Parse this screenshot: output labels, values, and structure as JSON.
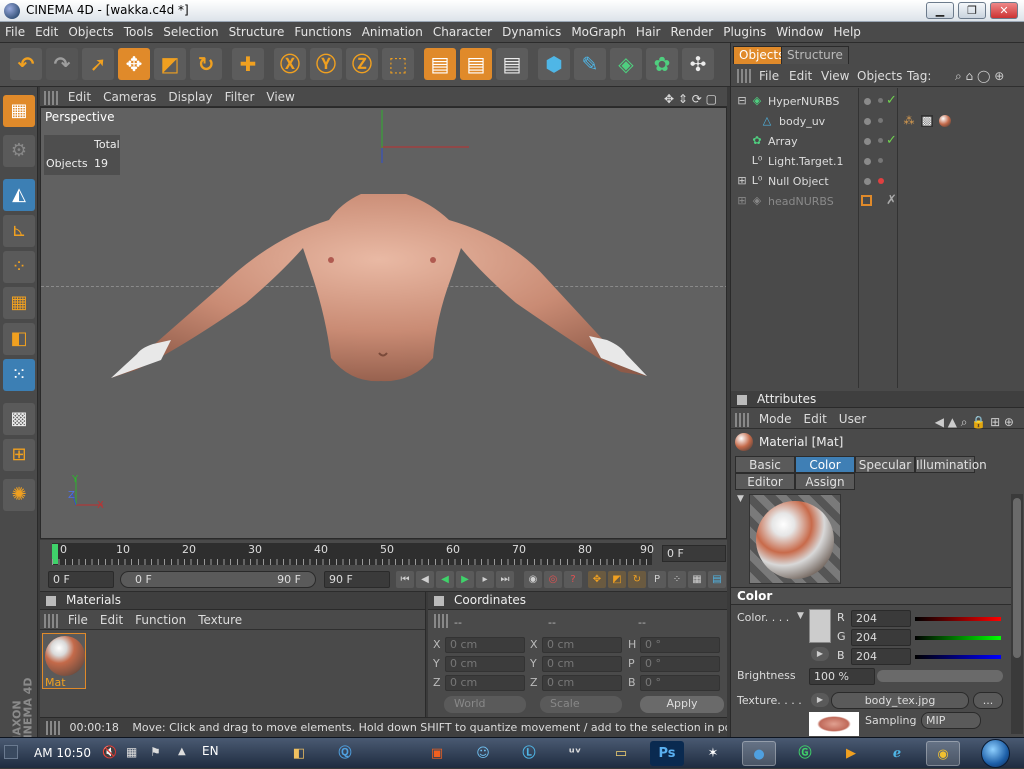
{
  "window": {
    "title": "CINEMA 4D - [wakka.c4d *]",
    "min": "▁",
    "max": "❐",
    "close": "✕"
  },
  "menubar": [
    "File",
    "Edit",
    "Objects",
    "Tools",
    "Selection",
    "Structure",
    "Functions",
    "Animation",
    "Character",
    "Dynamics",
    "MoGraph",
    "Hair",
    "Render",
    "Plugins",
    "Window",
    "Help"
  ],
  "viewport": {
    "menu": [
      "Edit",
      "Cameras",
      "Display",
      "Filter",
      "View"
    ],
    "label": "Perspective",
    "hud": {
      "header": "Total",
      "row_label": "Objects",
      "row_value": "19"
    },
    "axes": {
      "x": "X",
      "y": "Y",
      "z": "Z"
    }
  },
  "timeline": {
    "ticks": [
      "0",
      "10",
      "20",
      "30",
      "40",
      "50",
      "60",
      "70",
      "80",
      "90"
    ],
    "current_frame": "0 F",
    "start_field": "0 F",
    "range_start": "0 F",
    "range_end": "90 F",
    "end_field": "90 F"
  },
  "materials": {
    "title": "Materials",
    "menu": [
      "File",
      "Edit",
      "Function",
      "Texture"
    ],
    "items": [
      {
        "label": "Mat"
      }
    ]
  },
  "coordinates": {
    "title": "Coordinates",
    "col_headers": [
      "--",
      "--",
      "--"
    ],
    "rows": [
      {
        "a_label": "X",
        "a_value": "0 cm",
        "b_label": "X",
        "b_value": "0 cm",
        "c_label": "H",
        "c_value": "0 °"
      },
      {
        "a_label": "Y",
        "a_value": "0 cm",
        "b_label": "Y",
        "b_value": "0 cm",
        "c_label": "P",
        "c_value": "0 °"
      },
      {
        "a_label": "Z",
        "a_value": "0 cm",
        "b_label": "Z",
        "b_value": "0 cm",
        "c_label": "B",
        "c_value": "0 °"
      }
    ],
    "mode_select": "World",
    "scale_select": "Scale",
    "apply_label": "Apply"
  },
  "statusbar": {
    "time": "00:00:18",
    "message": "Move: Click and drag to move elements. Hold down SHIFT to quantize movement / add to the selection in point mode, CTRL to re"
  },
  "objects_panel": {
    "tabs": [
      "Objects",
      "Structure"
    ],
    "menu": [
      "File",
      "Edit",
      "View",
      "Objects",
      "Tag:"
    ],
    "rows": [
      {
        "name": "HyperNURBS",
        "state": "check"
      },
      {
        "name": "body_uv",
        "state": "tags"
      },
      {
        "name": "Array",
        "state": "check"
      },
      {
        "name": "Light.Target.1",
        "state": "none"
      },
      {
        "name": "Null Object",
        "state": "red"
      },
      {
        "name": "headNURBS",
        "state": "off"
      }
    ]
  },
  "attributes": {
    "title": "Attributes",
    "menu": [
      "Mode",
      "Edit",
      "User"
    ],
    "material_title": "Material [Mat]",
    "tabs_row1": [
      "Basic",
      "Color",
      "Specular",
      "Illumination"
    ],
    "tabs_row2": [
      "Editor",
      "Assign"
    ],
    "active_tab": "Color",
    "section": "Color",
    "color_label": "Color. . . .",
    "r_label": "R",
    "r_value": "204",
    "g_label": "G",
    "g_value": "204",
    "b_label": "B",
    "b_value": "204",
    "brightness_label": "Brightness",
    "brightness_value": "100 %",
    "texture_label": "Texture. . . .",
    "texture_file": "body_tex.jpg",
    "texture_more": "...",
    "sampling_label": "Sampling",
    "sampling_value": "MIP",
    "swatch_color": "#cccccc"
  },
  "taskbar": {
    "time": "AM 10:50",
    "lang": "EN"
  },
  "colors": {
    "accent": "#e08a2a",
    "selection_blue": "#3f7fb5",
    "panel": "#4a4a4a"
  }
}
